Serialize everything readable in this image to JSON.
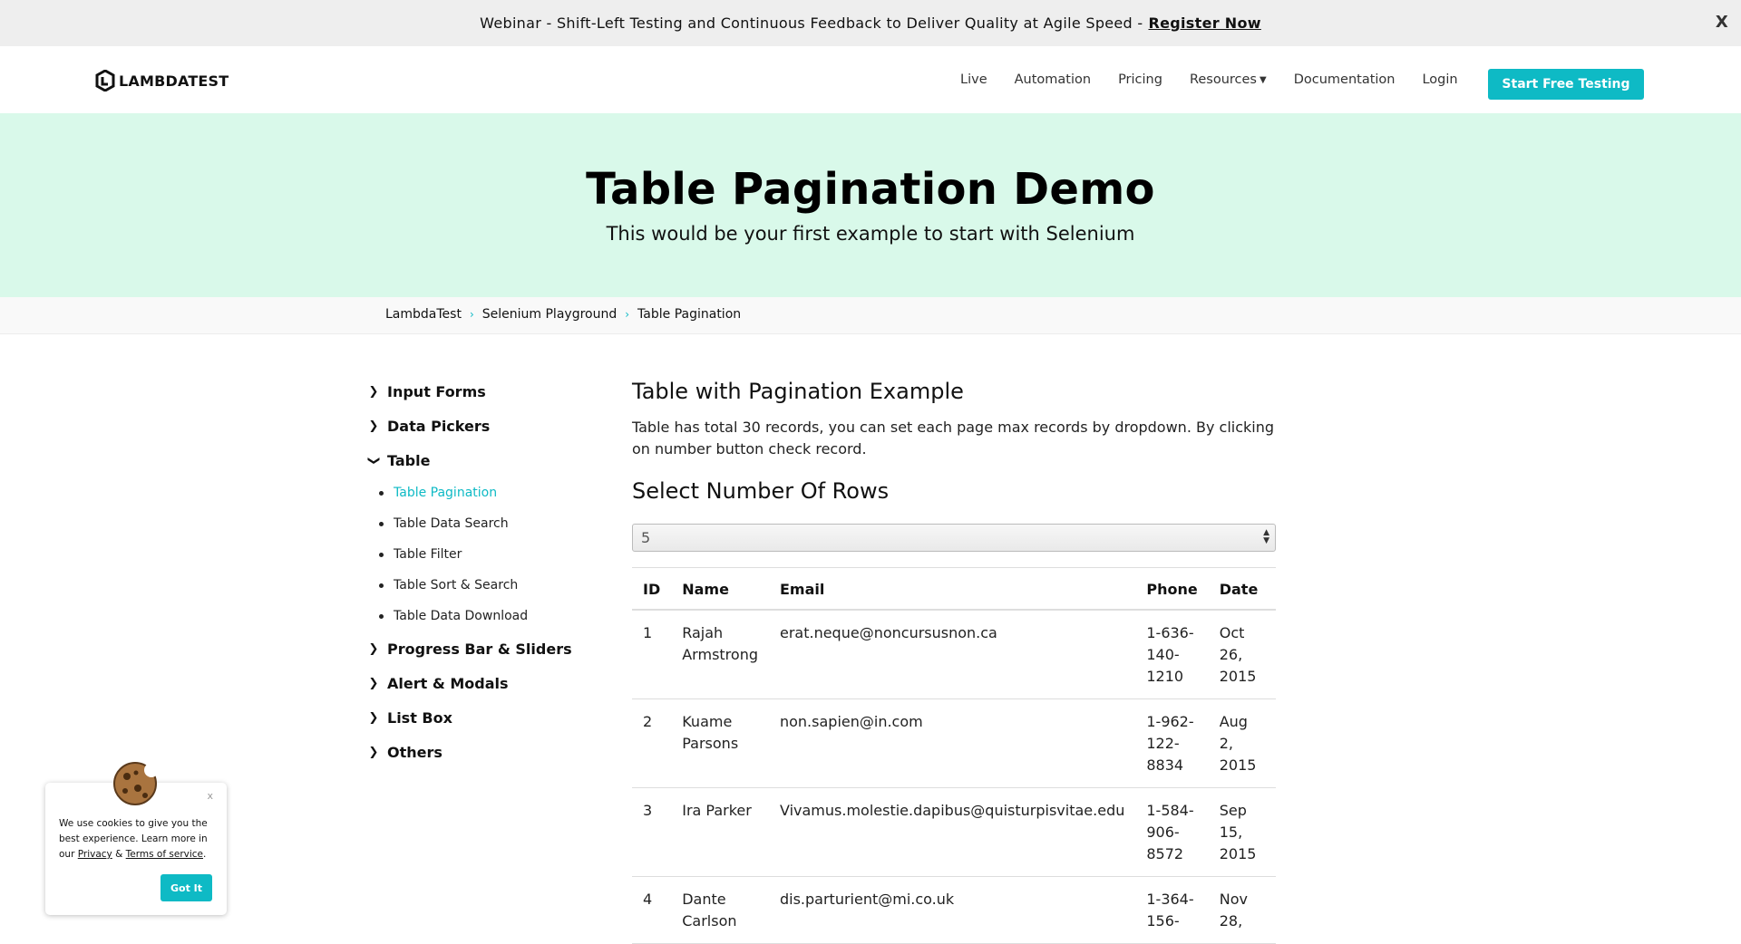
{
  "banner": {
    "text": "Webinar - Shift-Left Testing and Continuous Feedback to Deliver Quality at Agile Speed -",
    "link": "Register Now",
    "close": "X"
  },
  "header": {
    "logo": "LAMBDATEST",
    "nav": [
      "Live",
      "Automation",
      "Pricing",
      "Resources",
      "Documentation",
      "Login"
    ],
    "cta": "Start Free Testing"
  },
  "hero": {
    "title": "Table Pagination Demo",
    "subtitle": "This would be your first example to start with Selenium"
  },
  "breadcrumb": [
    "LambdaTest",
    "Selenium Playground",
    "Table Pagination"
  ],
  "sidebar": {
    "sections": [
      "Input Forms",
      "Data Pickers",
      "Table",
      "Progress Bar & Sliders",
      "Alert & Modals",
      "List Box",
      "Others"
    ],
    "table_items": [
      "Table Pagination",
      "Table Data Search",
      "Table Filter",
      "Table Sort & Search",
      "Table Data Download"
    ]
  },
  "main": {
    "title": "Table with Pagination Example",
    "description": "Table has total 30 records, you can set each page max records by dropdown. By clicking on number button check record.",
    "rows_title": "Select Number Of Rows",
    "rows_selected": "5",
    "columns": [
      "ID",
      "Name",
      "Email",
      "Phone",
      "Date"
    ],
    "rows": [
      {
        "id": "1",
        "name": "Rajah Armstrong",
        "email": "erat.neque@noncursusnon.ca",
        "phone": "1-636-140-1210",
        "date": "Oct 26, 2015"
      },
      {
        "id": "2",
        "name": "Kuame Parsons",
        "email": "non.sapien@in.com",
        "phone": "1-962-122-8834",
        "date": "Aug 2, 2015"
      },
      {
        "id": "3",
        "name": "Ira Parker",
        "email": "Vivamus.molestie.dapibus@quisturpisvitae.edu",
        "phone": "1-584-906-8572",
        "date": "Sep 15, 2015"
      },
      {
        "id": "4",
        "name": "Dante Carlson",
        "email": "dis.parturient@mi.co.uk",
        "phone": "1-364-156-",
        "date": "Nov 28,"
      }
    ]
  },
  "cookie": {
    "close": "x",
    "text_prefix": "We use cookies to give you the best experience. Learn more in our",
    "privacy": "Privacy",
    "amp": "&",
    "terms": "Terms of service",
    "period": ".",
    "button": "Got It"
  },
  "colors": {
    "accent": "#0ebac5",
    "hero_bg": "#d9f9ea",
    "banner_bg": "#eeeeee"
  }
}
